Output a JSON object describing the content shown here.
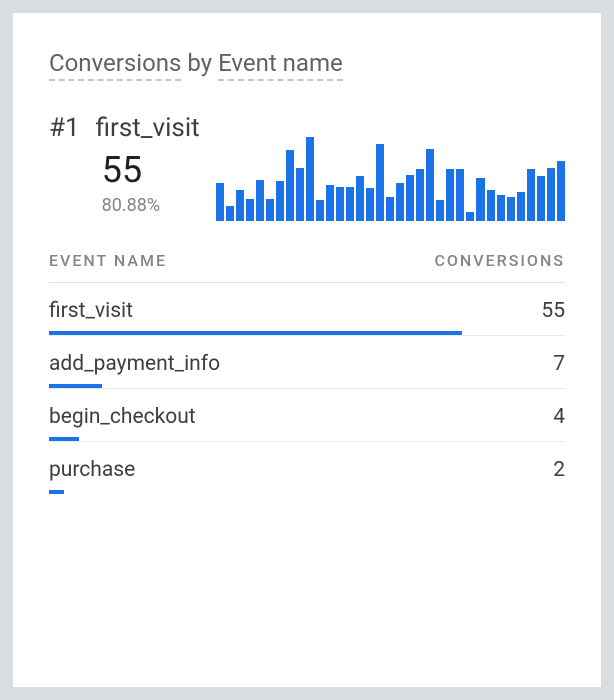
{
  "title": {
    "part1": "Conversions",
    "joiner": " by ",
    "part2": "Event name"
  },
  "hero": {
    "rank": "#1",
    "event": "first_visit",
    "value": "55",
    "pct": "80.88%"
  },
  "table": {
    "col1": "EVENT NAME",
    "col2": "CONVERSIONS"
  },
  "rows": [
    {
      "name": "first_visit",
      "value": "55"
    },
    {
      "name": "add_payment_info",
      "value": "7"
    },
    {
      "name": "begin_checkout",
      "value": "4"
    },
    {
      "name": "purchase",
      "value": "2"
    }
  ],
  "chart_data": {
    "type": "bar",
    "title": "Conversions by Event name — first_visit sparkline",
    "xlabel": "",
    "ylabel": "",
    "categories": [
      1,
      2,
      3,
      4,
      5,
      6,
      7,
      8,
      9,
      10,
      11,
      12,
      13,
      14,
      15,
      16,
      17,
      18,
      19,
      20,
      21,
      22,
      23,
      24,
      25,
      26,
      27,
      28,
      29,
      30,
      31,
      32,
      33,
      34,
      35
    ],
    "values": [
      44,
      18,
      36,
      26,
      48,
      26,
      46,
      82,
      62,
      98,
      24,
      42,
      40,
      40,
      52,
      38,
      90,
      28,
      44,
      54,
      60,
      84,
      24,
      60,
      60,
      10,
      50,
      36,
      30,
      28,
      34,
      60,
      52,
      62,
      70
    ],
    "ylim": [
      0,
      100
    ]
  },
  "row_bar_max": 55
}
